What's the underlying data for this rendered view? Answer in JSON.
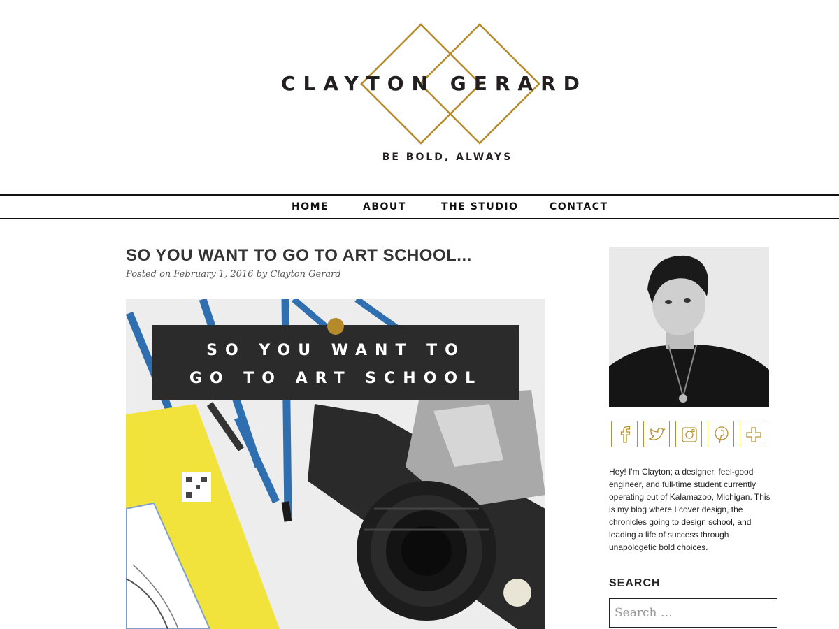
{
  "header": {
    "site_name": "CLAYTON GERARD",
    "tagline": "BE BOLD, ALWAYS",
    "accent_color": "#b58a2a"
  },
  "nav": {
    "items": [
      "HOME",
      "ABOUT",
      "THE STUDIO",
      "CONTACT"
    ]
  },
  "post": {
    "title": "SO YOU WANT TO GO TO ART SCHOOL...",
    "meta_prefix": "Posted on",
    "date": "February 1, 2016",
    "meta_by": "by",
    "author": "Clayton Gerard",
    "hero_line1": "SO YOU WANT TO",
    "hero_line2": "GO TO ART SCHOOL"
  },
  "sidebar": {
    "avatar_icon": "person-portrait",
    "social_icons": [
      "facebook-icon",
      "twitter-icon",
      "instagram-icon",
      "pinterest-icon",
      "plus-icon"
    ],
    "bio": "Hey! I'm Clayton; a designer, feel-good engineer, and full-time student currently operating out of Kalamazoo, Michigan. This is my blog where I cover design, the chronicles going to design school, and leading a life of success through unapologetic bold choices.",
    "search_heading": "SEARCH",
    "search_placeholder": "Search …"
  }
}
